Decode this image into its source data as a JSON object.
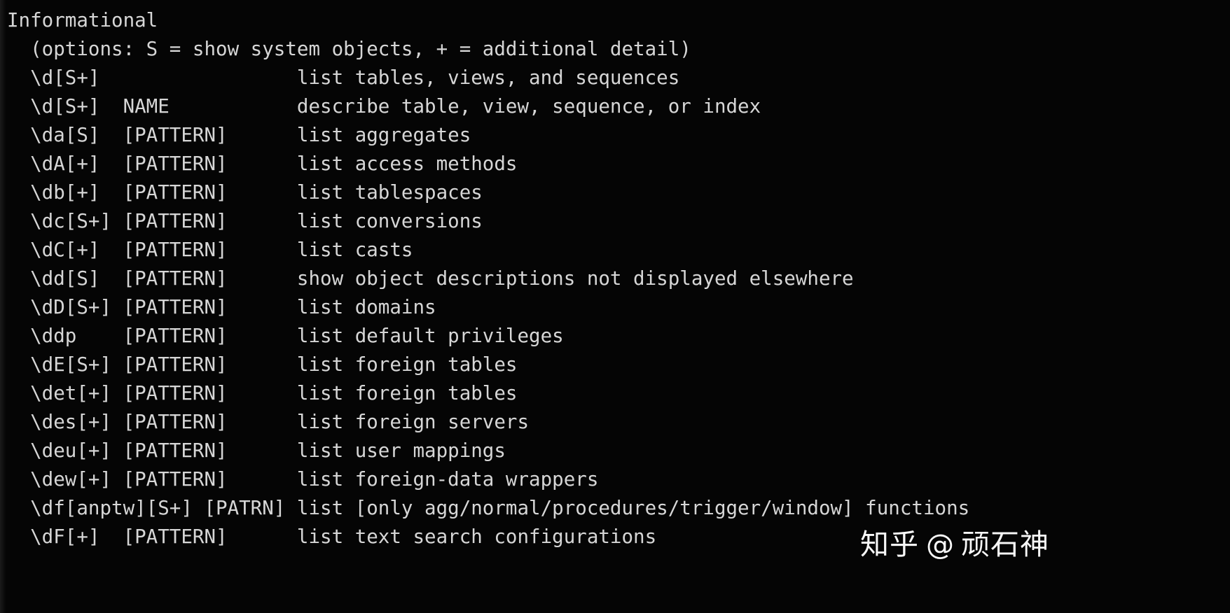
{
  "terminal": {
    "section_title": "Informational",
    "options_note": "  (options: S = show system objects, + = additional detail)",
    "command_column_width": 28,
    "lines": [
      "Informational",
      "  (options: S = show system objects, + = additional detail)",
      "  \\d[S+]                 list tables, views, and sequences",
      "  \\d[S+]  NAME           describe table, view, sequence, or index",
      "  \\da[S]  [PATTERN]      list aggregates",
      "  \\dA[+]  [PATTERN]      list access methods",
      "  \\db[+]  [PATTERN]      list tablespaces",
      "  \\dc[S+] [PATTERN]      list conversions",
      "  \\dC[+]  [PATTERN]      list casts",
      "  \\dd[S]  [PATTERN]      show object descriptions not displayed elsewhere",
      "  \\dD[S+] [PATTERN]      list domains",
      "  \\ddp    [PATTERN]      list default privileges",
      "  \\dE[S+] [PATTERN]      list foreign tables",
      "  \\det[+] [PATTERN]      list foreign tables",
      "  \\des[+] [PATTERN]      list foreign servers",
      "  \\deu[+] [PATTERN]      list user mappings",
      "  \\dew[+] [PATTERN]      list foreign-data wrappers",
      "  \\df[anptw][S+] [PATRN] list [only agg/normal/procedures/trigger/window] functions",
      "  \\dF[+]  [PATTERN]      list text search configurations"
    ],
    "entries": [
      {
        "command": "\\d[S+]",
        "argument": "",
        "description": "list tables, views, and sequences"
      },
      {
        "command": "\\d[S+]",
        "argument": "NAME",
        "description": "describe table, view, sequence, or index"
      },
      {
        "command": "\\da[S]",
        "argument": "[PATTERN]",
        "description": "list aggregates"
      },
      {
        "command": "\\dA[+]",
        "argument": "[PATTERN]",
        "description": "list access methods"
      },
      {
        "command": "\\db[+]",
        "argument": "[PATTERN]",
        "description": "list tablespaces"
      },
      {
        "command": "\\dc[S+]",
        "argument": "[PATTERN]",
        "description": "list conversions"
      },
      {
        "command": "\\dC[+]",
        "argument": "[PATTERN]",
        "description": "list casts"
      },
      {
        "command": "\\dd[S]",
        "argument": "[PATTERN]",
        "description": "show object descriptions not displayed elsewhere"
      },
      {
        "command": "\\dD[S+]",
        "argument": "[PATTERN]",
        "description": "list domains"
      },
      {
        "command": "\\ddp",
        "argument": "[PATTERN]",
        "description": "list default privileges"
      },
      {
        "command": "\\dE[S+]",
        "argument": "[PATTERN]",
        "description": "list foreign tables"
      },
      {
        "command": "\\det[+]",
        "argument": "[PATTERN]",
        "description": "list foreign tables"
      },
      {
        "command": "\\des[+]",
        "argument": "[PATTERN]",
        "description": "list foreign servers"
      },
      {
        "command": "\\deu[+]",
        "argument": "[PATTERN]",
        "description": "list user mappings"
      },
      {
        "command": "\\dew[+]",
        "argument": "[PATTERN]",
        "description": "list foreign-data wrappers"
      },
      {
        "command": "\\df[anptw][S+]",
        "argument": "[PATRN]",
        "description": "list [only agg/normal/procedures/trigger/window] functions"
      },
      {
        "command": "\\dF[+]",
        "argument": "[PATTERN]",
        "description": "list text search configurations"
      }
    ]
  },
  "watermark": {
    "brand": "知乎",
    "at": "@",
    "username": "顽石神"
  },
  "colors": {
    "background": "#050505",
    "foreground": "#d6d6d6",
    "watermark": "#ffffff"
  }
}
